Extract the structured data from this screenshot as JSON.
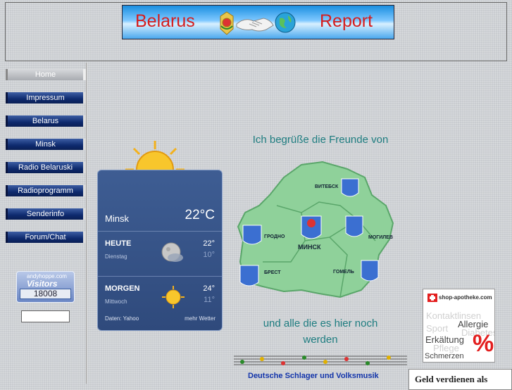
{
  "banner": {
    "left_word": "Belarus",
    "right_word": "Report"
  },
  "nav": {
    "items": [
      {
        "label": "Home",
        "active": true
      },
      {
        "label": "Impressum"
      },
      {
        "label": "Belarus"
      },
      {
        "label": "Minsk"
      },
      {
        "label": "Radio Belaruski"
      },
      {
        "label": "Radioprogramm"
      },
      {
        "label": "Senderinfo"
      },
      {
        "label": "Forum/Chat"
      }
    ]
  },
  "counter": {
    "site": "andyhoppe.com",
    "label": "Visitors",
    "value": "18008"
  },
  "weather": {
    "city": "Minsk",
    "temp": "22°C",
    "today": {
      "label": "HEUTE",
      "day": "Dienstag",
      "high": "22°",
      "low": "10°",
      "icon": "moon-cloud-icon"
    },
    "tomorrow": {
      "label": "MORGEN",
      "day": "Mittwoch",
      "high": "24°",
      "low": "11°",
      "icon": "sun-icon"
    },
    "source": "Daten: Yahoo",
    "more": "mehr Wetter"
  },
  "main": {
    "greeting": "Ich begrüße die Freunde von",
    "friends_line1": "und alle die es hier noch",
    "friends_line2": "werden"
  },
  "map": {
    "cities": [
      "ВИТЕБСК",
      "ГРОДНО",
      "МИНСК",
      "МОГИЛЕВ",
      "БРЕСТ",
      "ГОМЕЛЬ"
    ]
  },
  "music": {
    "link": "Deutsche Schlager und Volksmusik"
  },
  "ad": {
    "brand": "shop-apotheke.com",
    "bg_words": [
      "Kontaktlinsen",
      "Sport",
      "Diabetes",
      "Pflege"
    ],
    "words": [
      "Allergie",
      "Erkältung",
      "Schmerzen"
    ],
    "symbol": "%"
  },
  "earn": {
    "text": "Geld verdienen als"
  },
  "colors": {
    "nav_blue": "#0e2a6e",
    "teal_text": "#1e7d80",
    "banner_red": "#d61d1d"
  }
}
